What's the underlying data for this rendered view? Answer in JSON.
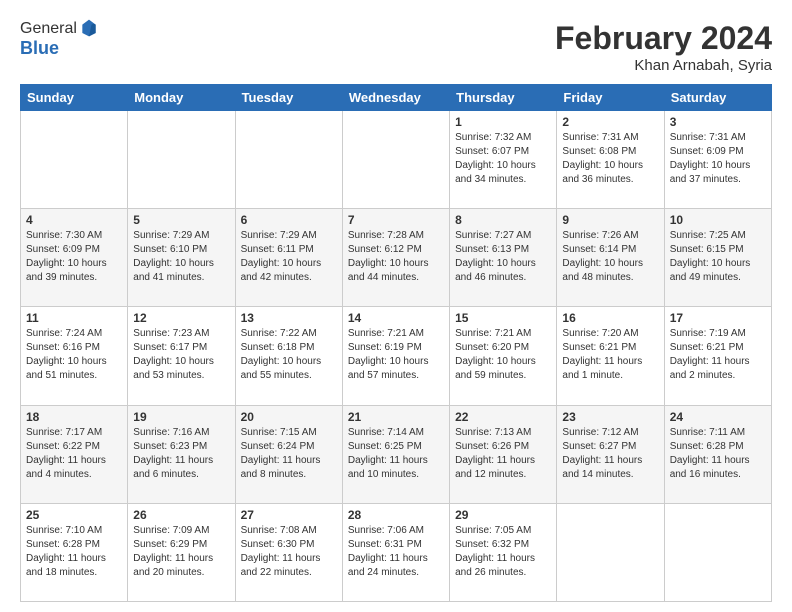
{
  "header": {
    "logo_line1": "General",
    "logo_line2": "Blue",
    "month": "February 2024",
    "location": "Khan Arnabah, Syria"
  },
  "weekdays": [
    "Sunday",
    "Monday",
    "Tuesday",
    "Wednesday",
    "Thursday",
    "Friday",
    "Saturday"
  ],
  "weeks": [
    [
      {
        "day": "",
        "info": ""
      },
      {
        "day": "",
        "info": ""
      },
      {
        "day": "",
        "info": ""
      },
      {
        "day": "",
        "info": ""
      },
      {
        "day": "1",
        "info": "Sunrise: 7:32 AM\nSunset: 6:07 PM\nDaylight: 10 hours\nand 34 minutes."
      },
      {
        "day": "2",
        "info": "Sunrise: 7:31 AM\nSunset: 6:08 PM\nDaylight: 10 hours\nand 36 minutes."
      },
      {
        "day": "3",
        "info": "Sunrise: 7:31 AM\nSunset: 6:09 PM\nDaylight: 10 hours\nand 37 minutes."
      }
    ],
    [
      {
        "day": "4",
        "info": "Sunrise: 7:30 AM\nSunset: 6:09 PM\nDaylight: 10 hours\nand 39 minutes."
      },
      {
        "day": "5",
        "info": "Sunrise: 7:29 AM\nSunset: 6:10 PM\nDaylight: 10 hours\nand 41 minutes."
      },
      {
        "day": "6",
        "info": "Sunrise: 7:29 AM\nSunset: 6:11 PM\nDaylight: 10 hours\nand 42 minutes."
      },
      {
        "day": "7",
        "info": "Sunrise: 7:28 AM\nSunset: 6:12 PM\nDaylight: 10 hours\nand 44 minutes."
      },
      {
        "day": "8",
        "info": "Sunrise: 7:27 AM\nSunset: 6:13 PM\nDaylight: 10 hours\nand 46 minutes."
      },
      {
        "day": "9",
        "info": "Sunrise: 7:26 AM\nSunset: 6:14 PM\nDaylight: 10 hours\nand 48 minutes."
      },
      {
        "day": "10",
        "info": "Sunrise: 7:25 AM\nSunset: 6:15 PM\nDaylight: 10 hours\nand 49 minutes."
      }
    ],
    [
      {
        "day": "11",
        "info": "Sunrise: 7:24 AM\nSunset: 6:16 PM\nDaylight: 10 hours\nand 51 minutes."
      },
      {
        "day": "12",
        "info": "Sunrise: 7:23 AM\nSunset: 6:17 PM\nDaylight: 10 hours\nand 53 minutes."
      },
      {
        "day": "13",
        "info": "Sunrise: 7:22 AM\nSunset: 6:18 PM\nDaylight: 10 hours\nand 55 minutes."
      },
      {
        "day": "14",
        "info": "Sunrise: 7:21 AM\nSunset: 6:19 PM\nDaylight: 10 hours\nand 57 minutes."
      },
      {
        "day": "15",
        "info": "Sunrise: 7:21 AM\nSunset: 6:20 PM\nDaylight: 10 hours\nand 59 minutes."
      },
      {
        "day": "16",
        "info": "Sunrise: 7:20 AM\nSunset: 6:21 PM\nDaylight: 11 hours\nand 1 minute."
      },
      {
        "day": "17",
        "info": "Sunrise: 7:19 AM\nSunset: 6:21 PM\nDaylight: 11 hours\nand 2 minutes."
      }
    ],
    [
      {
        "day": "18",
        "info": "Sunrise: 7:17 AM\nSunset: 6:22 PM\nDaylight: 11 hours\nand 4 minutes."
      },
      {
        "day": "19",
        "info": "Sunrise: 7:16 AM\nSunset: 6:23 PM\nDaylight: 11 hours\nand 6 minutes."
      },
      {
        "day": "20",
        "info": "Sunrise: 7:15 AM\nSunset: 6:24 PM\nDaylight: 11 hours\nand 8 minutes."
      },
      {
        "day": "21",
        "info": "Sunrise: 7:14 AM\nSunset: 6:25 PM\nDaylight: 11 hours\nand 10 minutes."
      },
      {
        "day": "22",
        "info": "Sunrise: 7:13 AM\nSunset: 6:26 PM\nDaylight: 11 hours\nand 12 minutes."
      },
      {
        "day": "23",
        "info": "Sunrise: 7:12 AM\nSunset: 6:27 PM\nDaylight: 11 hours\nand 14 minutes."
      },
      {
        "day": "24",
        "info": "Sunrise: 7:11 AM\nSunset: 6:28 PM\nDaylight: 11 hours\nand 16 minutes."
      }
    ],
    [
      {
        "day": "25",
        "info": "Sunrise: 7:10 AM\nSunset: 6:28 PM\nDaylight: 11 hours\nand 18 minutes."
      },
      {
        "day": "26",
        "info": "Sunrise: 7:09 AM\nSunset: 6:29 PM\nDaylight: 11 hours\nand 20 minutes."
      },
      {
        "day": "27",
        "info": "Sunrise: 7:08 AM\nSunset: 6:30 PM\nDaylight: 11 hours\nand 22 minutes."
      },
      {
        "day": "28",
        "info": "Sunrise: 7:06 AM\nSunset: 6:31 PM\nDaylight: 11 hours\nand 24 minutes."
      },
      {
        "day": "29",
        "info": "Sunrise: 7:05 AM\nSunset: 6:32 PM\nDaylight: 11 hours\nand 26 minutes."
      },
      {
        "day": "",
        "info": ""
      },
      {
        "day": "",
        "info": ""
      }
    ]
  ]
}
